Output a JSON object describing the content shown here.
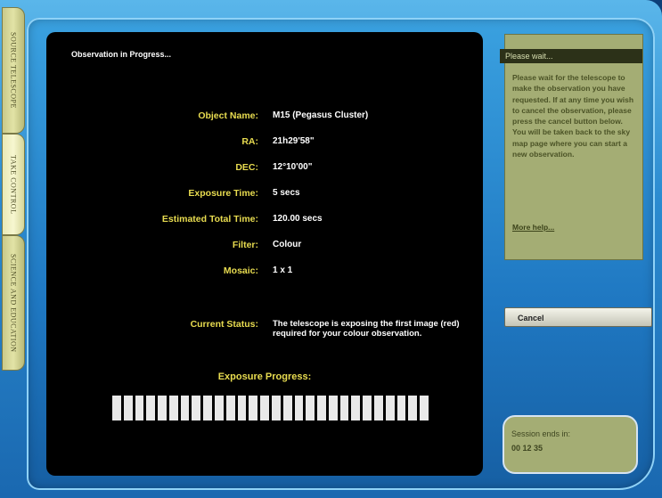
{
  "tabs": [
    {
      "label": "SOURCE TELESCOPE"
    },
    {
      "label": "TAKE CONTROL"
    },
    {
      "label": "SCIENCE AND EDUCATION"
    }
  ],
  "main": {
    "title": "Observation in Progress...",
    "fields": [
      {
        "label": "Object Name:",
        "value": "M15 (Pegasus Cluster)"
      },
      {
        "label": "RA:",
        "value": "21h29'58\""
      },
      {
        "label": "DEC:",
        "value": "12°10'00\""
      },
      {
        "label": "Exposure Time:",
        "value": "5 secs"
      },
      {
        "label": "Estimated Total Time:",
        "value": "120.00 secs"
      },
      {
        "label": "Filter:",
        "value": "Colour"
      },
      {
        "label": "Mosaic:",
        "value": "1 x 1"
      }
    ],
    "status_label": "Current Status:",
    "status_value": "The telescope is exposing the first image (red) required for your colour observation.",
    "progress_label": "Exposure Progress:",
    "progress_fraction": 1.0
  },
  "side": {
    "header": "Please wait...",
    "text": "Please wait for the telescope to make the observation you have requested. If at any time you wish to cancel the observation, please press the cancel button below. You will be taken back to the sky map page where you can start a new observation.",
    "help_link": "More help..."
  },
  "cancel_label": "Cancel",
  "session": {
    "label": "Session ends in:",
    "time": "00 12 35"
  },
  "colors": {
    "accent_yellow": "#e8dc50",
    "frame_blue": "#2b8bd0",
    "panel_green": "#a4ad74"
  }
}
